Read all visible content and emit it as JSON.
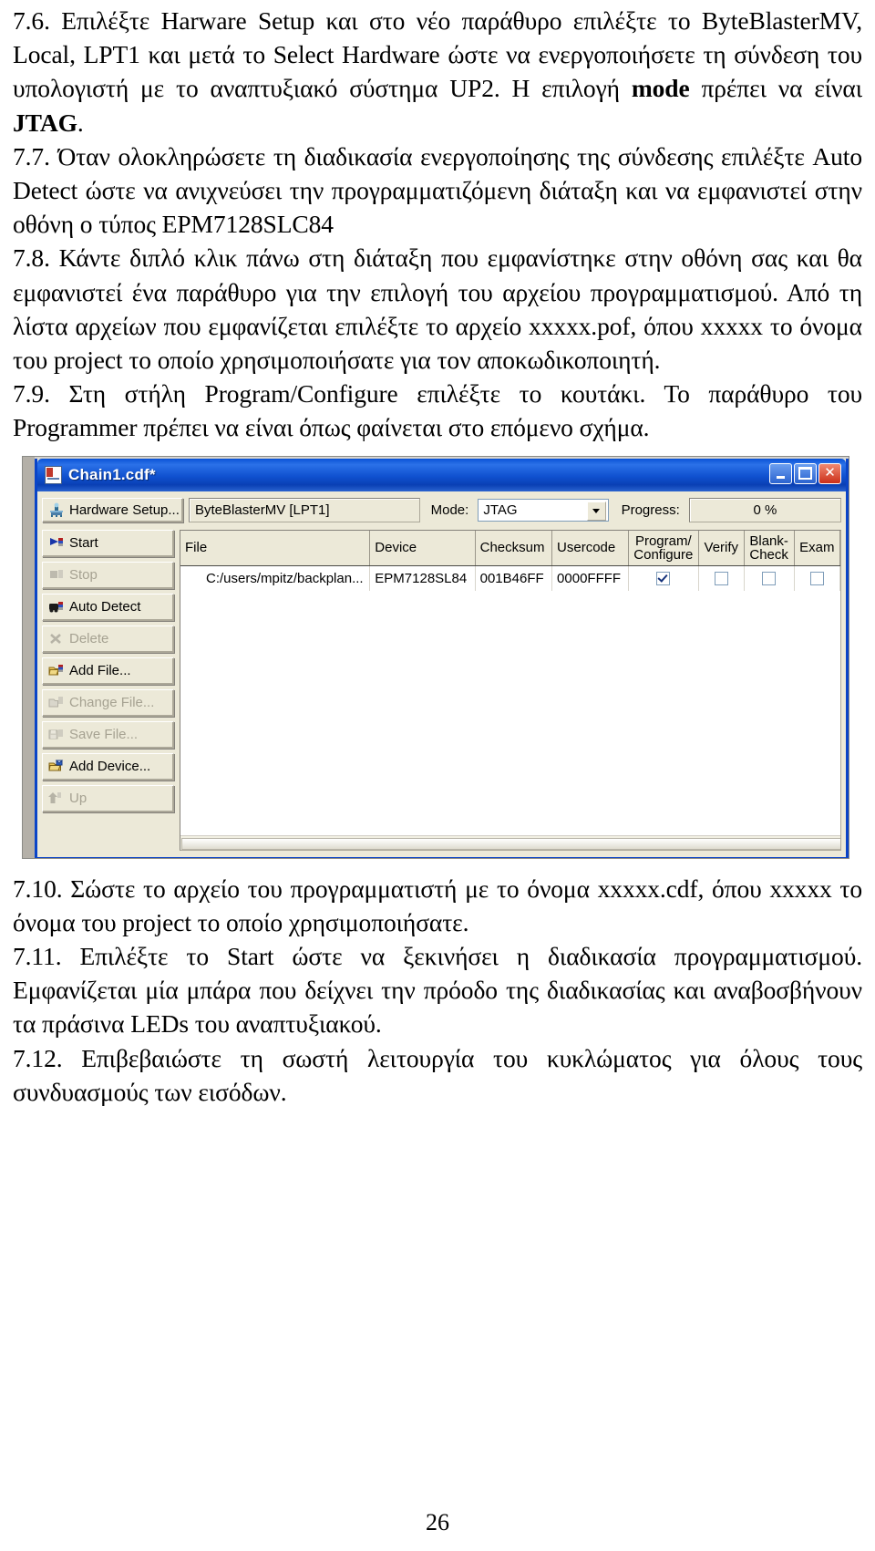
{
  "document": {
    "page_number": "26",
    "paragraphs_top": [
      "7.6. Επιλέξτε Harware Setup και στο νέο παράθυρο επιλέξτε το ByteBlasterMV, Local, LPT1 και μετά το Select Hardware ώστε να ενεργοποιήσετε τη σύνδεση του υπολογιστή με το αναπτυξιακό σύστημα UP2. Η επιλογή ",
      "mode",
      " πρέπει να είναι ",
      "JTAG",
      ".",
      "7.7. Όταν ολοκληρώσετε τη διαδικασία ενεργοποίησης της σύνδεσης επιλέξτε Auto Detect ώστε να ανιχνεύσει την προγραμματιζόμενη διάταξη και να εμφανιστεί στην οθόνη ο τύπος EPM7128SLC84",
      "7.8. Κάντε διπλό κλικ πάνω στη διάταξη που εμφανίστηκε στην οθόνη σας και θα εμφανιστεί ένα παράθυρο για την επιλογή του αρχείου προγραμματισμού. Από τη λίστα αρχείων που εμφανίζεται επιλέξτε το αρχείο xxxxx.pof, όπου xxxxx το όνομα του project το οποίο χρησιμοποιήσατε για τον αποκωδικοποιητή.",
      "7.9. Στη στήλη Program/Configure επιλέξτε το κουτάκι. Το παράθυρο του Programmer πρέπει να είναι όπως φαίνεται στο επόμενο σχήμα."
    ],
    "paragraphs_bottom": [
      "7.10. Σώστε το αρχείο του προγραμματιστή με το όνομα xxxxx.cdf, όπου xxxxx το όνομα του project το οποίο χρησιμοποιήσατε.",
      "7.11. Επιλέξτε το Start ώστε να ξεκινήσει η διαδικασία προγραμματισμού. Εμφανίζεται μία μπάρα που δείχνει την πρόοδο της διαδικασίας και αναβοσβήνουν τα πράσινα LEDs του αναπτυξιακού.",
      "7.12. Επιβεβαιώστε τη σωστή λειτουργία του κυκλώματος για όλους τους συνδυασμούς των εισόδων."
    ]
  },
  "programmer_window": {
    "title": "Chain1.cdf*",
    "title_icon": "document-icon",
    "window_buttons": {
      "minimize": "minimize-icon",
      "maximize": "maximize-icon",
      "close": "close-icon"
    },
    "toolbar": {
      "hardware_setup_label": "Hardware Setup...",
      "hardware_value": "ByteBlasterMV [LPT1]",
      "mode_label": "Mode:",
      "mode_value": "JTAG",
      "progress_label": "Progress:",
      "progress_value": "0 %"
    },
    "side_buttons": [
      {
        "label": "Start",
        "enabled": true,
        "icon": "start-flag-icon"
      },
      {
        "label": "Stop",
        "enabled": false,
        "icon": "stop-icon"
      },
      {
        "label": "Auto Detect",
        "enabled": true,
        "icon": "auto-detect-icon"
      },
      {
        "label": "Delete",
        "enabled": false,
        "icon": "delete-x-icon"
      },
      {
        "label": "Add File...",
        "enabled": true,
        "icon": "add-file-folder-icon"
      },
      {
        "label": "Change File...",
        "enabled": false,
        "icon": "change-file-icon"
      },
      {
        "label": "Save File...",
        "enabled": false,
        "icon": "save-file-disk-icon"
      },
      {
        "label": "Add Device...",
        "enabled": true,
        "icon": "add-device-folder-icon"
      },
      {
        "label": "Up",
        "enabled": false,
        "icon": "up-arrow-icon"
      }
    ],
    "table": {
      "columns": [
        "File",
        "Device",
        "Checksum",
        "Usercode",
        "Program/\nConfigure",
        "Verify",
        "Blank-\nCheck",
        "Exam"
      ],
      "rows": [
        {
          "file": "C:/users/mpitz/backplan...",
          "device": "EPM7128SL84",
          "checksum": "001B46FF",
          "usercode": "0000FFFF",
          "program_configure": true,
          "verify": false,
          "blank_check": false,
          "examine": false
        }
      ]
    }
  },
  "colors": {
    "titlebar_blue": "#0a52d6",
    "window_face": "#ece9d8",
    "border_blue": "#0a44c8",
    "close_red": "#cc2f19"
  }
}
